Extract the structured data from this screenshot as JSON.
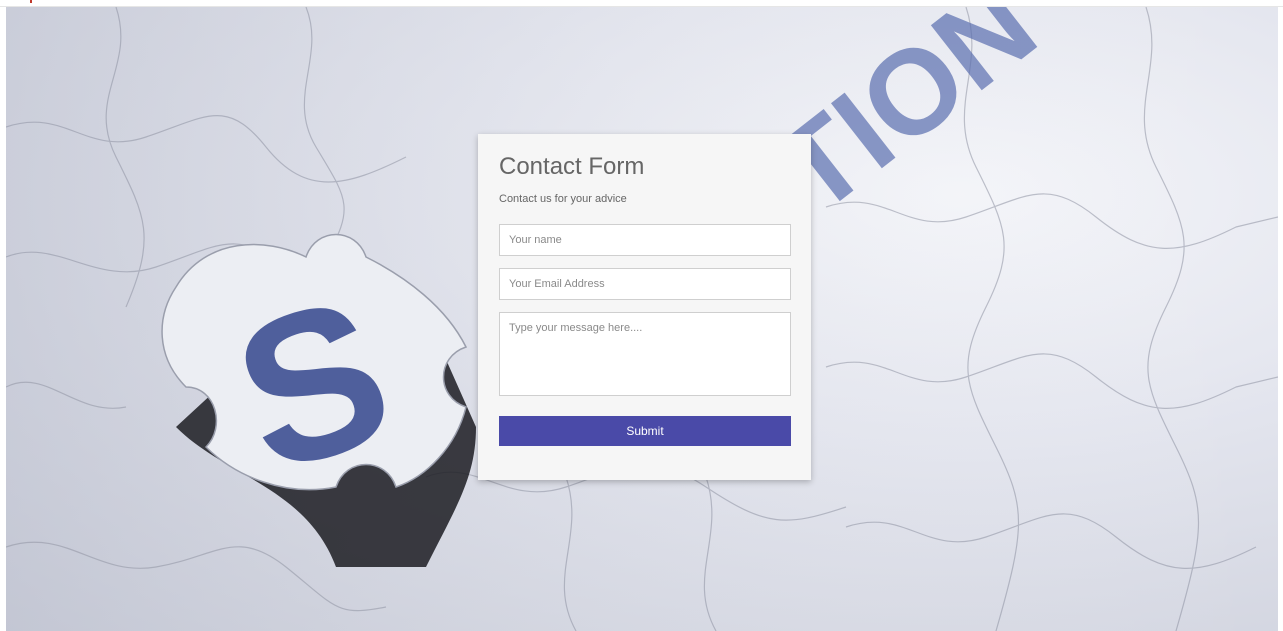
{
  "form": {
    "title": "Contact Form",
    "subtitle": "Contact us for your advice",
    "name_placeholder": "Your name",
    "email_placeholder": "Your Email Address",
    "message_placeholder": "Type your message here....",
    "submit_label": "Submit"
  },
  "background": {
    "letter": "S",
    "word_fragment": "TION"
  },
  "colors": {
    "accent": "#4a4aa8",
    "card": "#f6f6f6",
    "puzzle_letter": "#4f5f9c"
  }
}
